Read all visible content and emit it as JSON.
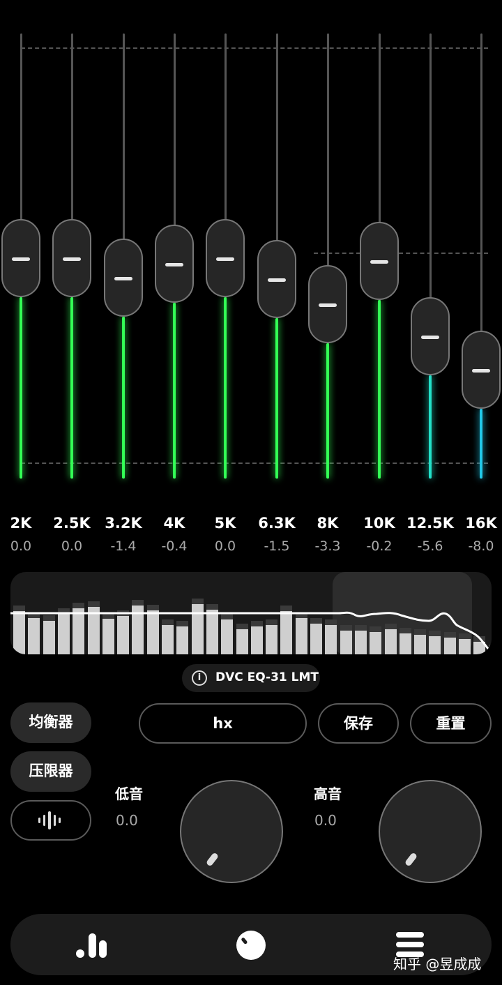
{
  "eq": {
    "bands": [
      {
        "label": "2K",
        "value": "0.0",
        "color": "#33ff55"
      },
      {
        "label": "2.5K",
        "value": "0.0",
        "color": "#33ff55"
      },
      {
        "label": "3.2K",
        "value": "-1.4",
        "color": "#33ff55"
      },
      {
        "label": "4K",
        "value": "-0.4",
        "color": "#33ff55"
      },
      {
        "label": "5K",
        "value": "0.0",
        "color": "#33ff55"
      },
      {
        "label": "6.3K",
        "value": "-1.5",
        "color": "#33ff55"
      },
      {
        "label": "8K",
        "value": "-3.3",
        "color": "#33ff55"
      },
      {
        "label": "10K",
        "value": "-0.2",
        "color": "#33ff55"
      },
      {
        "label": "12.5K",
        "value": "-5.6",
        "color": "#22e0c8"
      },
      {
        "label": "16K",
        "value": "-8.0",
        "color": "#22c8e8"
      }
    ],
    "range_db": [
      -15,
      15
    ]
  },
  "spectrum": {
    "levels": [
      0.62,
      0.52,
      0.48,
      0.58,
      0.66,
      0.68,
      0.51,
      0.55,
      0.7,
      0.63,
      0.42,
      0.4,
      0.72,
      0.64,
      0.5,
      0.36,
      0.4,
      0.42,
      0.62,
      0.52,
      0.44,
      0.42,
      0.34,
      0.34,
      0.32,
      0.36,
      0.3,
      0.28,
      0.26,
      0.24,
      0.22,
      0.18,
      0.06
    ]
  },
  "processor_chip": {
    "icon": "info-icon",
    "label": "DVC EQ-31 LMT"
  },
  "mode_buttons": {
    "equalizer": "均衡器",
    "limiter": "压限器",
    "waveform_icon": "waveform-icon"
  },
  "preset": {
    "name": "hx",
    "save": "保存",
    "reset": "重置"
  },
  "tone": {
    "bass": {
      "label": "低音",
      "value": "0.0"
    },
    "treble": {
      "label": "高音",
      "value": "0.0"
    }
  },
  "nav": {
    "items": [
      "equalizer-bars-icon",
      "knob-icon",
      "menu-icon"
    ]
  },
  "watermark": "知乎 @昱成成",
  "colors": {
    "accent_green": "#33ff55",
    "accent_cyan": "#22c8e8",
    "background": "#000000"
  }
}
